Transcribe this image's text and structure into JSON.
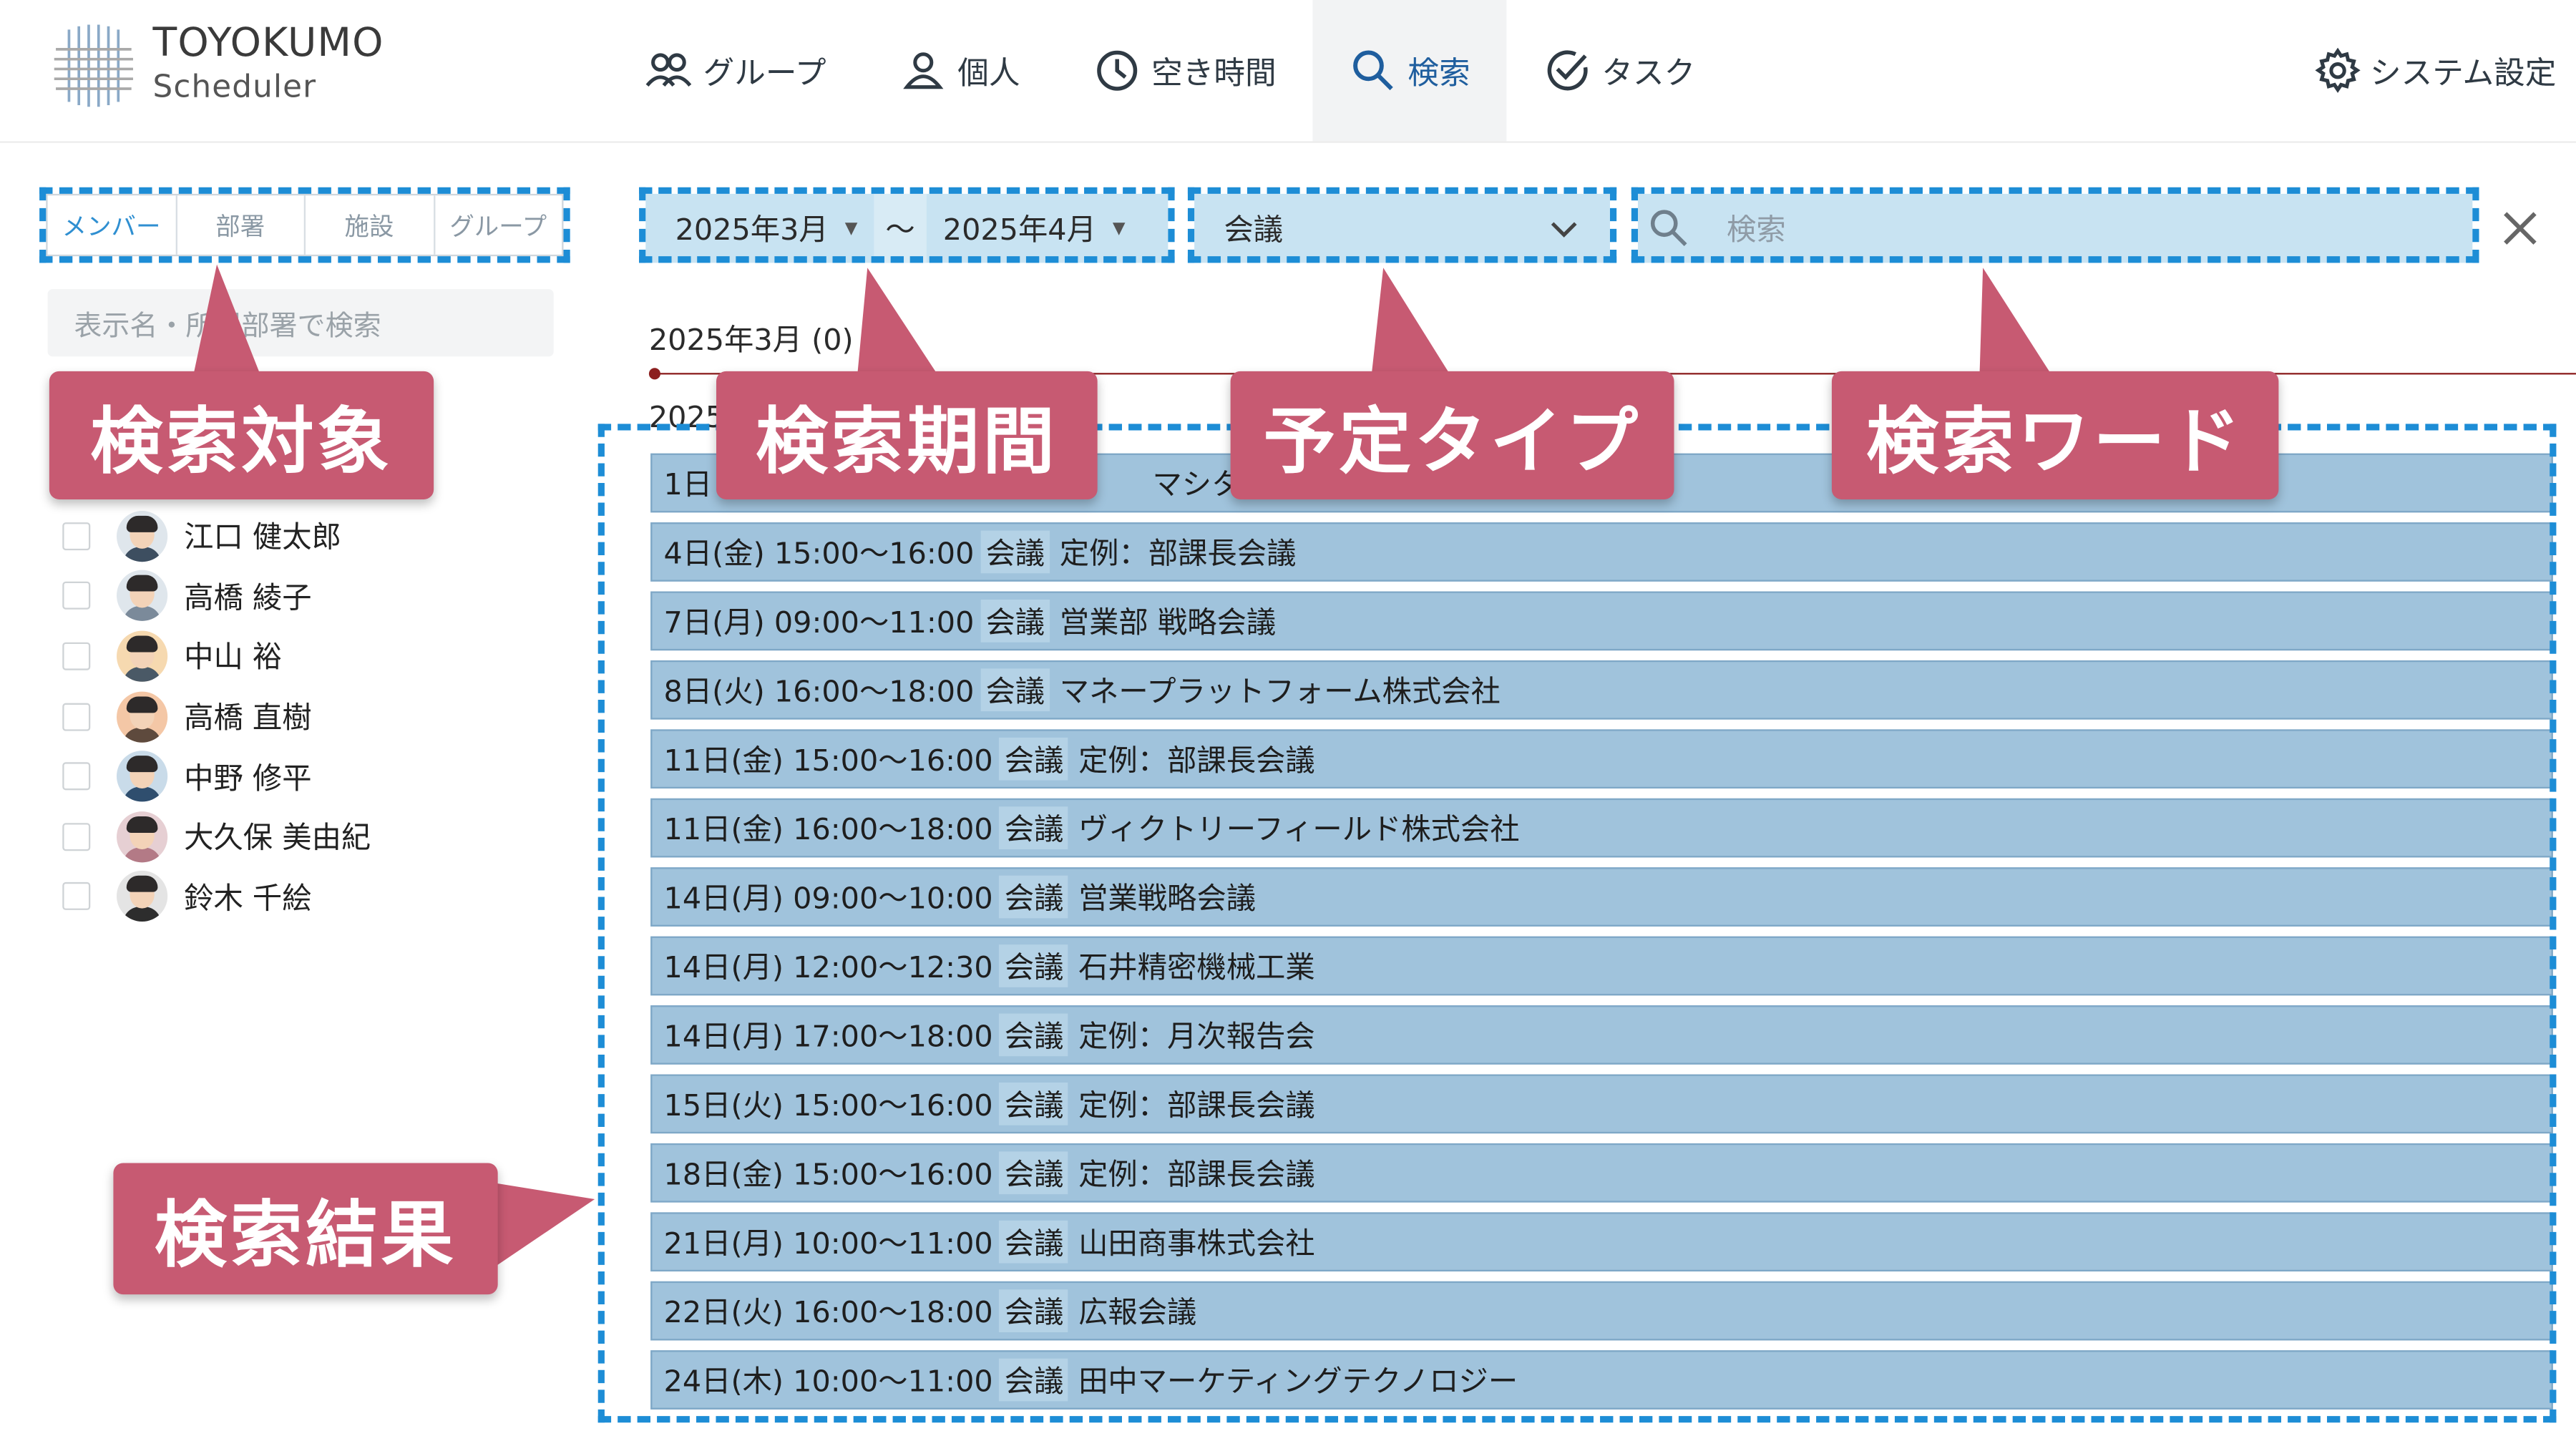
{
  "brand": {
    "name": "TOYOKUMO",
    "product": "Scheduler"
  },
  "nav": [
    {
      "label": "グループ",
      "icon": "group-icon"
    },
    {
      "label": "個人",
      "icon": "person-icon"
    },
    {
      "label": "空き時間",
      "icon": "clock-icon"
    },
    {
      "label": "検索",
      "icon": "search-icon",
      "active": true
    },
    {
      "label": "タスク",
      "icon": "task-check-icon"
    }
  ],
  "settings_label": "システム設定",
  "search_target": {
    "tabs": [
      "メンバー",
      "部署",
      "施設",
      "グループ"
    ],
    "active_index": 0,
    "placeholder": "表示名・所属部署で検索"
  },
  "members": [
    "江口 健太郎",
    "高橋 綾子",
    "中山 裕",
    "高橋 直樹",
    "中野 修平",
    "大久保 美由紀",
    "鈴木 千絵"
  ],
  "period": {
    "from": "2025年3月",
    "separator": "〜",
    "to": "2025年4月"
  },
  "event_type": {
    "selected": "会議"
  },
  "keyword": {
    "placeholder": "検索"
  },
  "month_header": "2025年3月 (0)",
  "month_header2": "2025",
  "results": [
    {
      "date": "1日",
      "type": "",
      "title": "マシタ実業"
    },
    {
      "date": "4日(金) 15:00〜16:00",
      "type": "会議",
      "title": "定例：部課長会議"
    },
    {
      "date": "7日(月) 09:00〜11:00",
      "type": "会議",
      "title": "営業部 戦略会議"
    },
    {
      "date": "8日(火) 16:00〜18:00",
      "type": "会議",
      "title": "マネープラットフォーム株式会社"
    },
    {
      "date": "11日(金) 15:00〜16:00",
      "type": "会議",
      "title": "定例：部課長会議"
    },
    {
      "date": "11日(金) 16:00〜18:00",
      "type": "会議",
      "title": "ヴィクトリーフィールド株式会社"
    },
    {
      "date": "14日(月) 09:00〜10:00",
      "type": "会議",
      "title": "営業戦略会議"
    },
    {
      "date": "14日(月) 12:00〜12:30",
      "type": "会議",
      "title": "石井精密機械工業"
    },
    {
      "date": "14日(月) 17:00〜18:00",
      "type": "会議",
      "title": "定例：月次報告会"
    },
    {
      "date": "15日(火) 15:00〜16:00",
      "type": "会議",
      "title": "定例：部課長会議"
    },
    {
      "date": "18日(金) 15:00〜16:00",
      "type": "会議",
      "title": "定例：部課長会議"
    },
    {
      "date": "21日(月) 10:00〜11:00",
      "type": "会議",
      "title": "山田商事株式会社"
    },
    {
      "date": "22日(火) 16:00〜18:00",
      "type": "会議",
      "title": "広報会議"
    },
    {
      "date": "24日(木) 10:00〜11:00",
      "type": "会議",
      "title": "田中マーケティングテクノロジー"
    }
  ],
  "callouts": {
    "target": "検索対象",
    "period": "検索期間",
    "type": "予定タイプ",
    "keyword": "検索ワード",
    "results": "検索結果"
  },
  "colors": {
    "callout": "#c75a72",
    "dashed_frame": "#1d8dd6",
    "result_row": "#a0c3dc",
    "field_bg": "#c8e3f2"
  }
}
